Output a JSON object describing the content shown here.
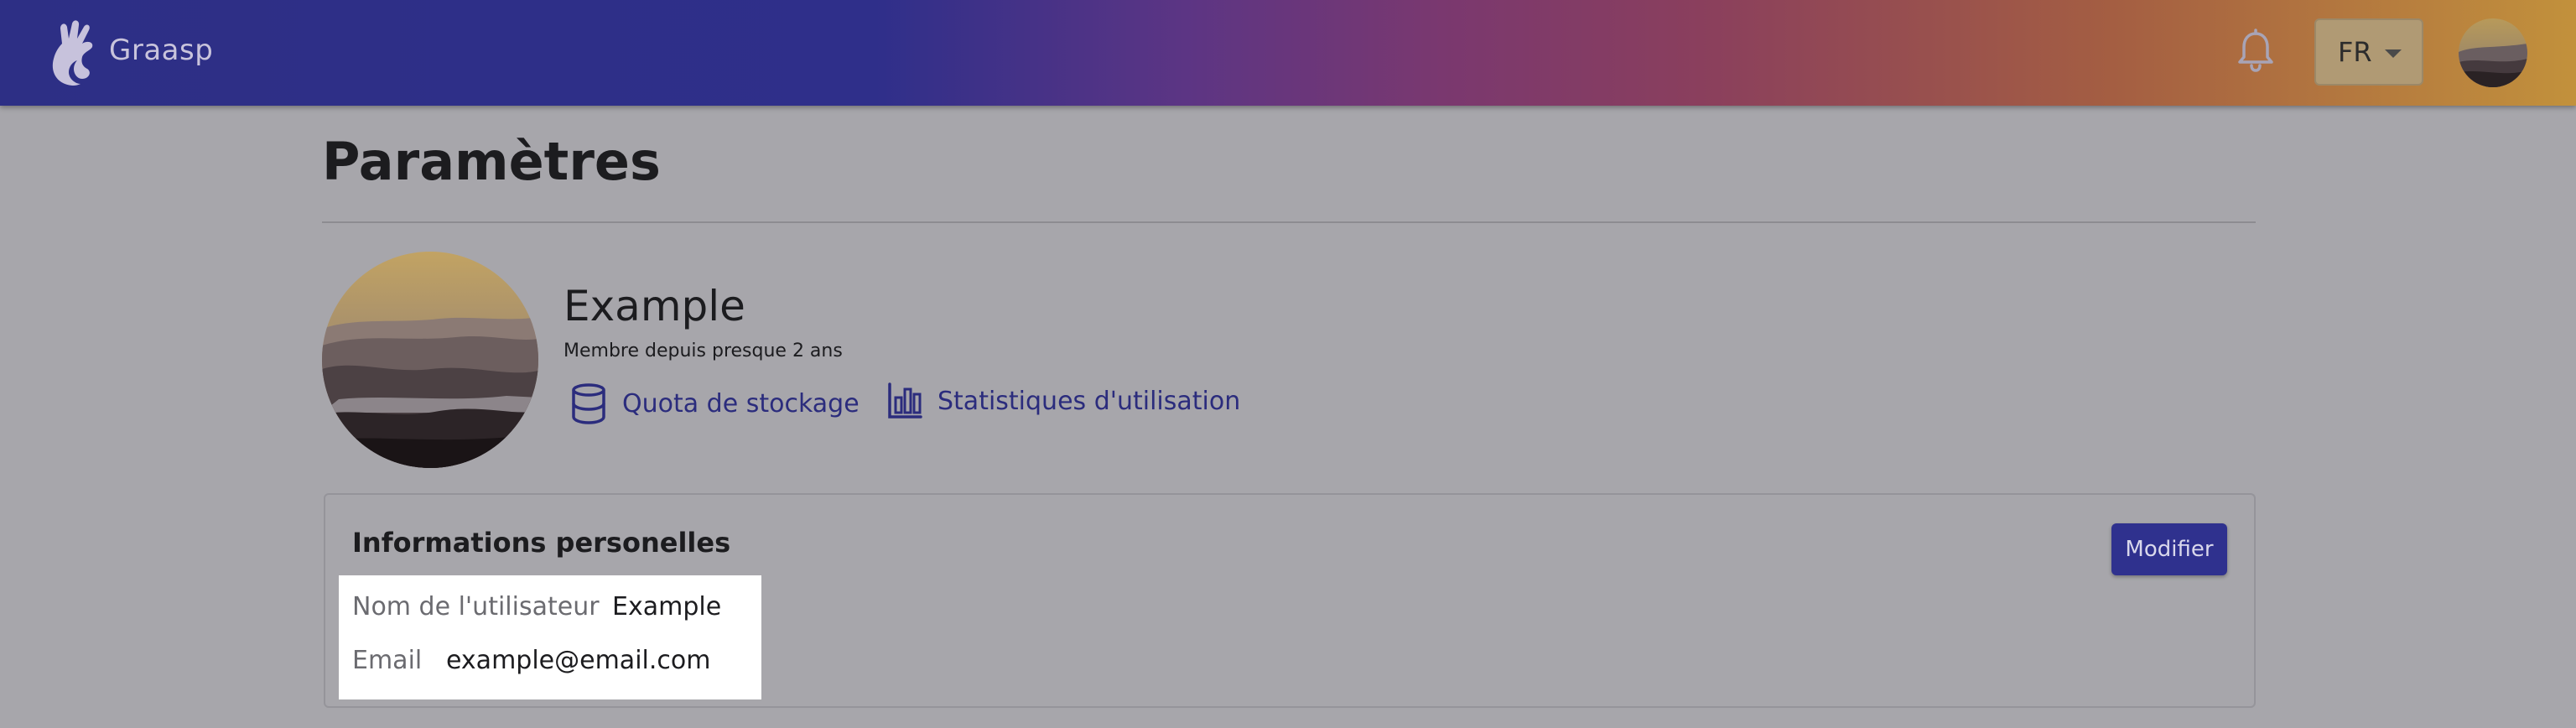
{
  "header": {
    "brand": "Graasp",
    "language": "FR",
    "gradient_colors": [
      "#2d2f85",
      "#5c3584",
      "#8a3f5d",
      "#c2913c"
    ]
  },
  "page": {
    "title": "Paramètres"
  },
  "profile": {
    "name": "Example",
    "member_since": "Membre depuis presque 2 ans",
    "links": {
      "storage": "Quota de stockage",
      "stats": "Statistiques d'utilisation"
    }
  },
  "personal_info": {
    "title": "Informations personelles",
    "edit_label": "Modifier",
    "username_label": "Nom de l'utilisateur",
    "username_value": "Example",
    "email_label": "Email",
    "email_value": "example@email.com"
  },
  "icons": [
    "graasp-logo-icon",
    "bell-icon",
    "chevron-down-icon",
    "database-icon",
    "bar-chart-icon"
  ],
  "colors": {
    "accent": "#2f318e",
    "link": "#2b2c7d",
    "overlay_background": "#a7a6ab"
  }
}
